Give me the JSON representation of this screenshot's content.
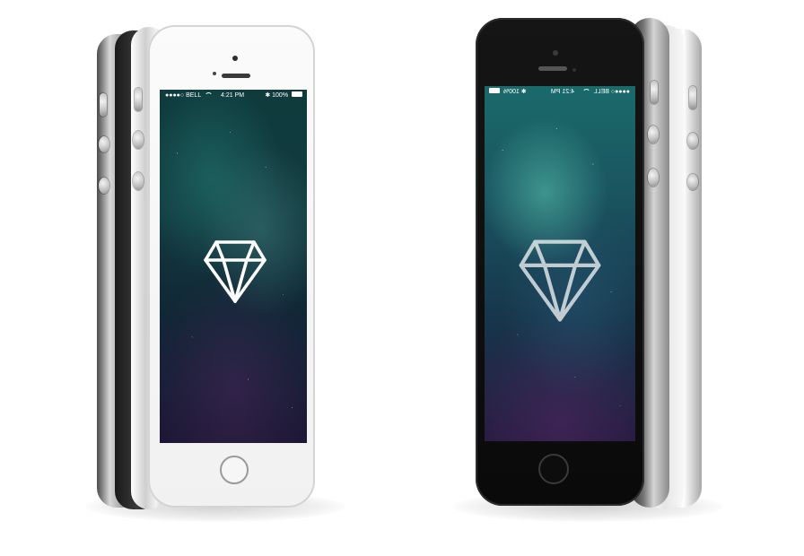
{
  "phones": [
    {
      "id": "left",
      "color": "white-silver",
      "status": {
        "carrier": "BELL",
        "time": "4:21 PM",
        "battery": "100%"
      },
      "screen_icon": "diamond-icon"
    },
    {
      "id": "right",
      "color": "space-gray",
      "mirrored": true,
      "status": {
        "carrier": "BELL",
        "time": "4:21 PM",
        "battery": "100%"
      },
      "screen_icon": "diamond-icon"
    }
  ],
  "colors": {
    "background": "#ffffff",
    "white_face": "#f7f7f7",
    "black_face": "#0b0b0b",
    "aluminum": "#c9c9c9",
    "screen_teal": "#1a5560"
  }
}
